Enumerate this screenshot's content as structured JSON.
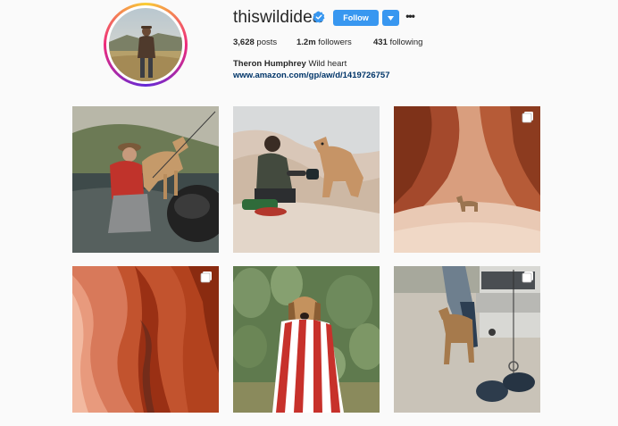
{
  "profile": {
    "username": "thiswildidea",
    "verified": true,
    "follow_label": "Follow",
    "more_label": "•••",
    "stats": {
      "posts_count": "3,628",
      "posts_label": "posts",
      "followers_count": "1.2m",
      "followers_label": "followers",
      "following_count": "431",
      "following_label": "following"
    },
    "full_name": "Theron Humphrey",
    "bio_text": "Wild heart",
    "link": "www.amazon.com/gp/aw/d/1419726757"
  },
  "colors": {
    "accent": "#3897f0",
    "link": "#003569",
    "text": "#262626",
    "background": "#fafafa"
  },
  "posts": [
    {
      "subject": "man in red shirt fishing with dog on rock",
      "multi": false
    },
    {
      "subject": "man pouring drink with dog on white rocks",
      "multi": false
    },
    {
      "subject": "dog in red slot canyon",
      "multi": true
    },
    {
      "subject": "orange slot canyon walls",
      "multi": true
    },
    {
      "subject": "dog wrapped in striped towel among cacti",
      "multi": false
    },
    {
      "subject": "dog near truck with waders and boots",
      "multi": true
    }
  ]
}
